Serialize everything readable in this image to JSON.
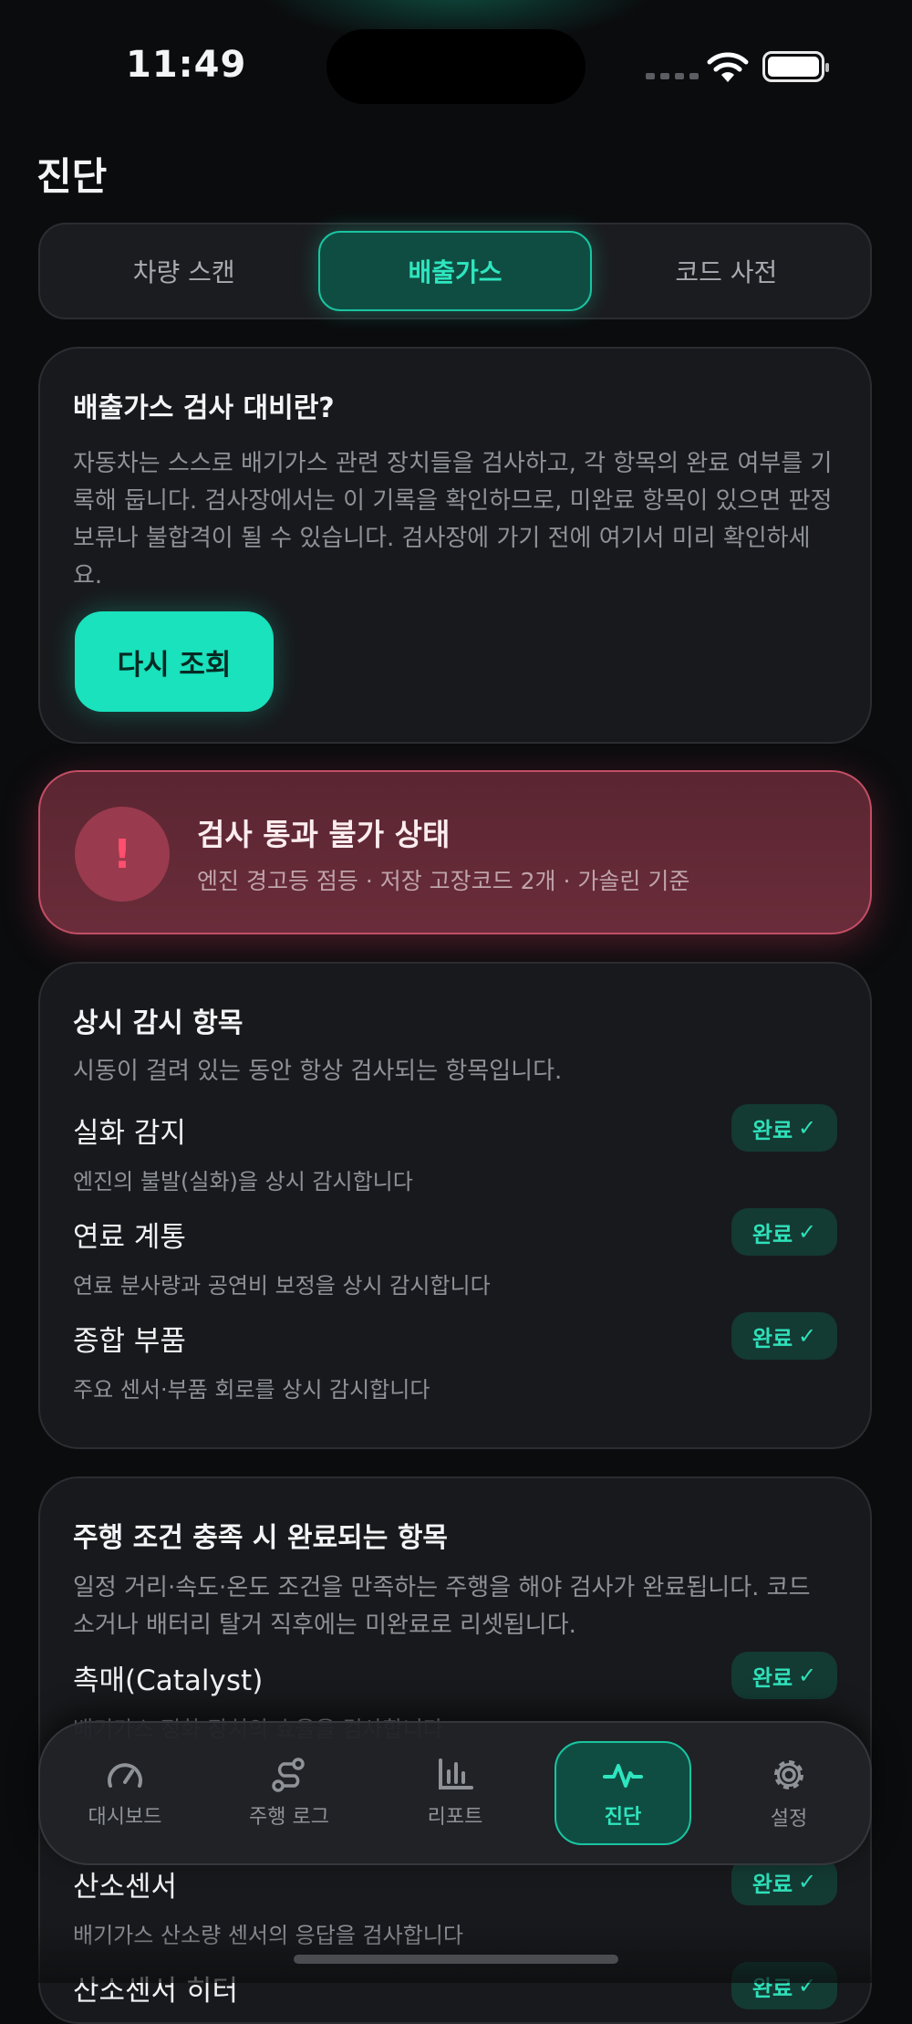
{
  "status_bar": {
    "time": "11:49"
  },
  "page": {
    "title": "진단"
  },
  "segments": [
    "차량 스캔",
    "배출가스",
    "코드 사전"
  ],
  "info_card": {
    "title": "배출가스 검사 대비란?",
    "description": "자동차는 스스로 배기가스 관련 장치들을 검사하고, 각 항목의 완료 여부를 기록해 둡니다. 검사장에서는 이 기록을 확인하므로, 미완료 항목이 있으면 판정 보류나 불합격이 될 수 있습니다. 검사장에 가기 전에 여기서 미리 확인하세요.",
    "button": "다시 조회"
  },
  "alert": {
    "icon": "!",
    "title": "검사 통과 불가 상태",
    "subtitle": "엔진 경고등 점등 · 저장 고장코드 2개 · 가솔린 기준"
  },
  "monitor_card": {
    "title": "상시 감시 항목",
    "description": "시동이 걸려 있는 동안 항상 검사되는 항목입니다.",
    "items": [
      {
        "name": "실화 감지",
        "sub": "엔진의 불발(실화)을 상시 감시합니다",
        "status": "완료"
      },
      {
        "name": "연료 계통",
        "sub": "연료 분사량과 공연비 보정을 상시 감시합니다",
        "status": "완료"
      },
      {
        "name": "종합 부품",
        "sub": "주요 센서·부품 회로를 상시 감시합니다",
        "status": "완료"
      }
    ]
  },
  "drive_card": {
    "title": "주행 조건 충족 시 완료되는 항목",
    "description": "일정 거리·속도·온도 조건을 만족하는 주행을 해야 검사가 완료됩니다. 코드 소거나 배터리 탈거 직후에는 미완료로 리셋됩니다.",
    "items": [
      {
        "name": "촉매(Catalyst)",
        "sub": "배기가스 정화 장치의 효율을 검사합니다",
        "status": "완료"
      },
      {
        "name": "산소센서",
        "sub": "배기가스 산소량 센서의 응답을 검사합니다",
        "status": "완료"
      },
      {
        "name": "산소센서 히터",
        "sub": "",
        "status": "완료"
      }
    ]
  },
  "tabbar": {
    "tabs": [
      {
        "label": "대시보드",
        "icon": "gauge-icon"
      },
      {
        "label": "주행 로그",
        "icon": "route-icon"
      },
      {
        "label": "리포트",
        "icon": "bar-chart-icon"
      },
      {
        "label": "진단",
        "icon": "pulse-icon"
      },
      {
        "label": "설정",
        "icon": "gear-icon"
      }
    ],
    "active": "진단"
  },
  "colors": {
    "accent": "#19E2BD",
    "alert": "#C44E66",
    "background": "#0B0C0E"
  }
}
